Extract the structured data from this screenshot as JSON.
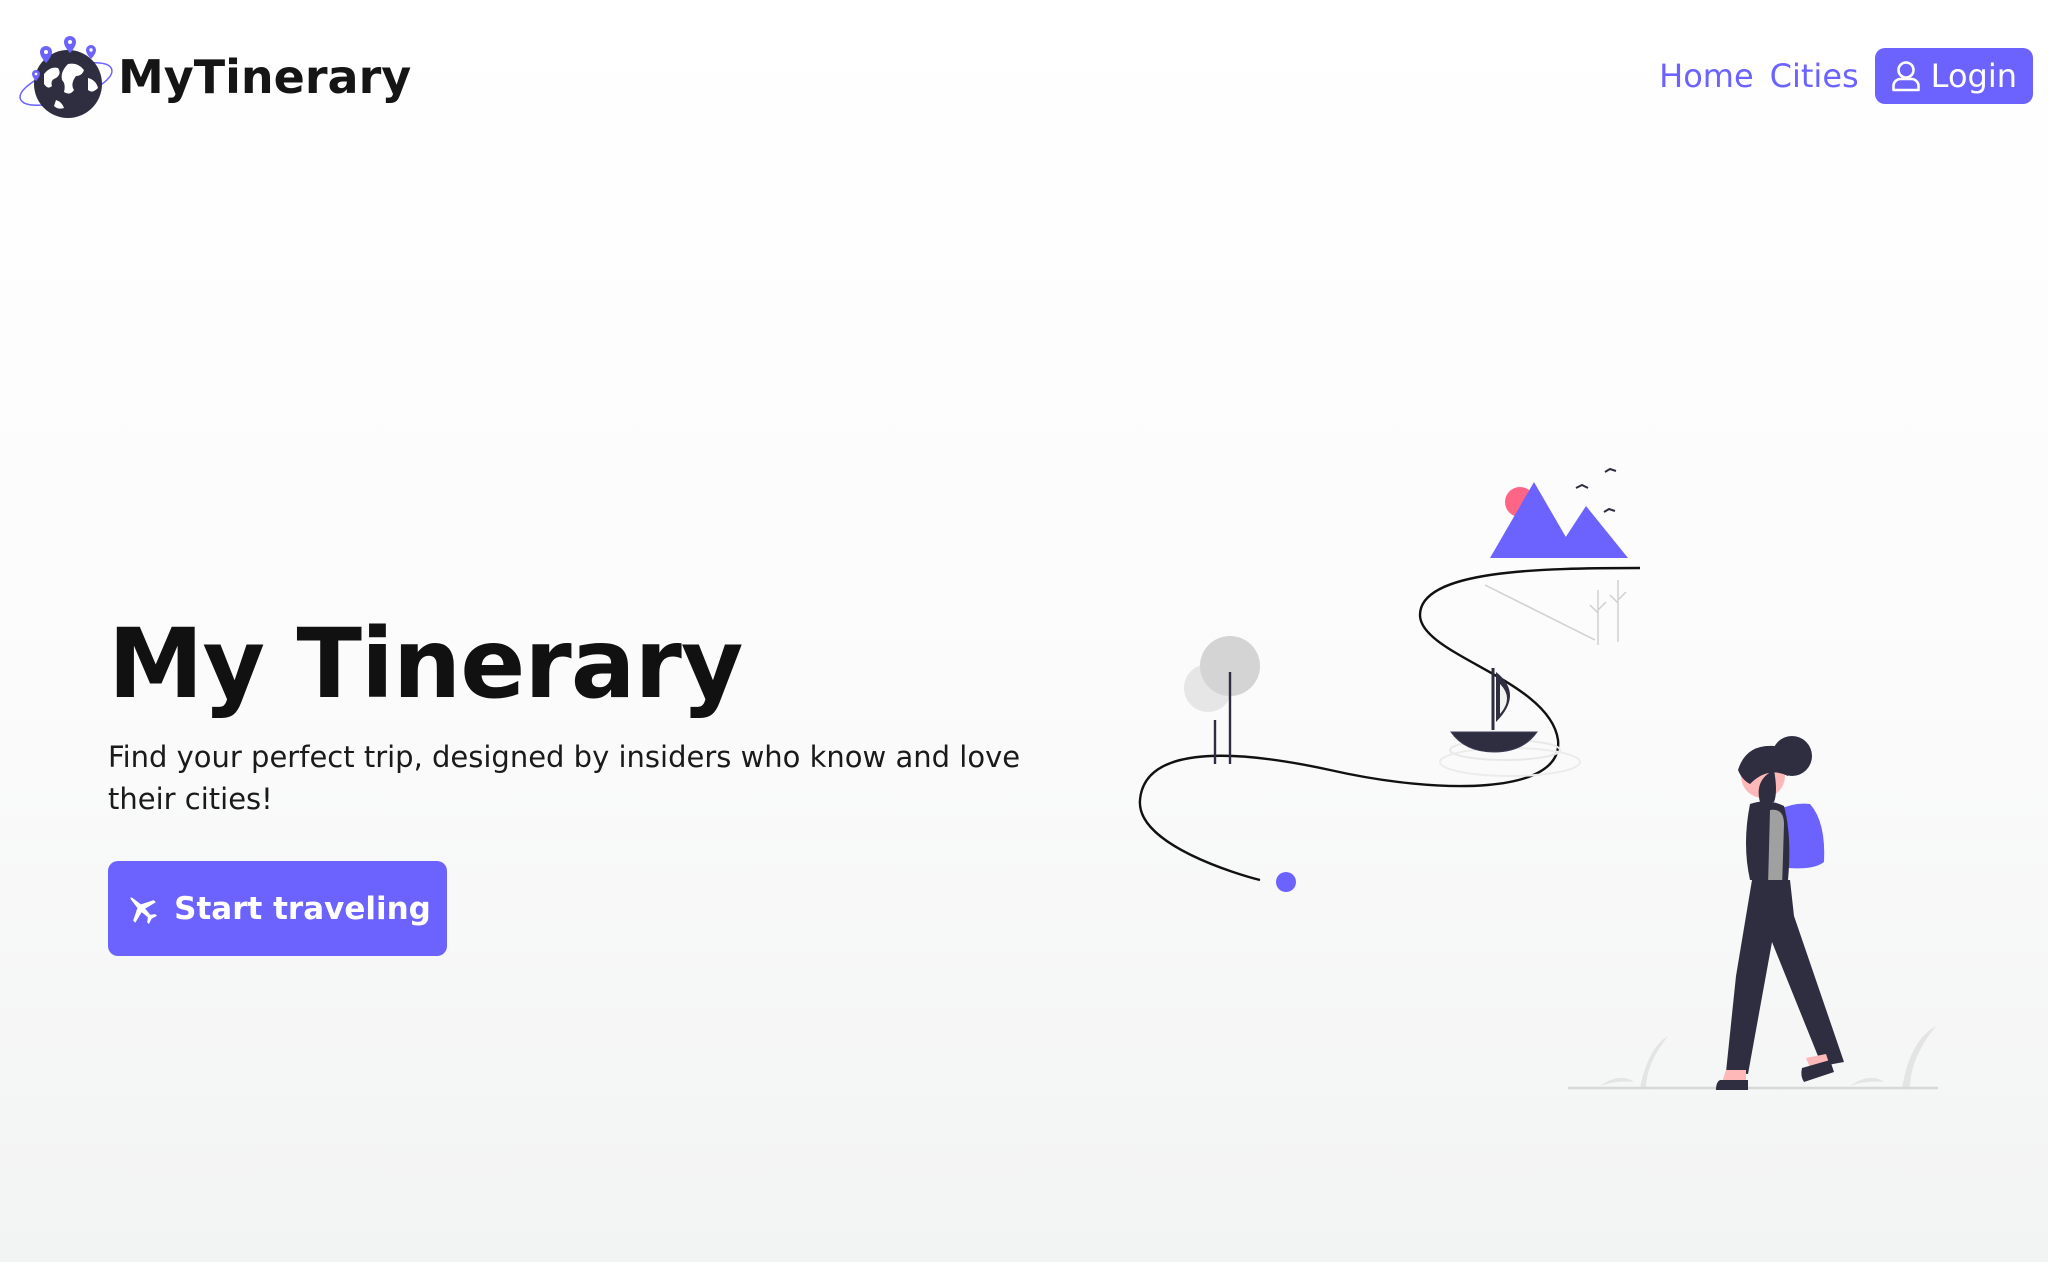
{
  "navbar": {
    "brand_name": "MyTinerary",
    "brand_icon": "globe-pins-logo",
    "links": [
      {
        "label": "Home"
      },
      {
        "label": "Cities"
      }
    ],
    "login": {
      "label": "Login",
      "icon": "user-icon"
    }
  },
  "hero": {
    "title": "My Tinerary",
    "subtitle": "Find your perfect trip, designed by insiders who know and love their cities!",
    "cta": {
      "label": "Start traveling",
      "icon": "airplane-icon"
    }
  },
  "colors": {
    "accent": "#6c63ff",
    "sun": "#ff6584",
    "dark": "#2f2e41",
    "text": "#111111"
  }
}
